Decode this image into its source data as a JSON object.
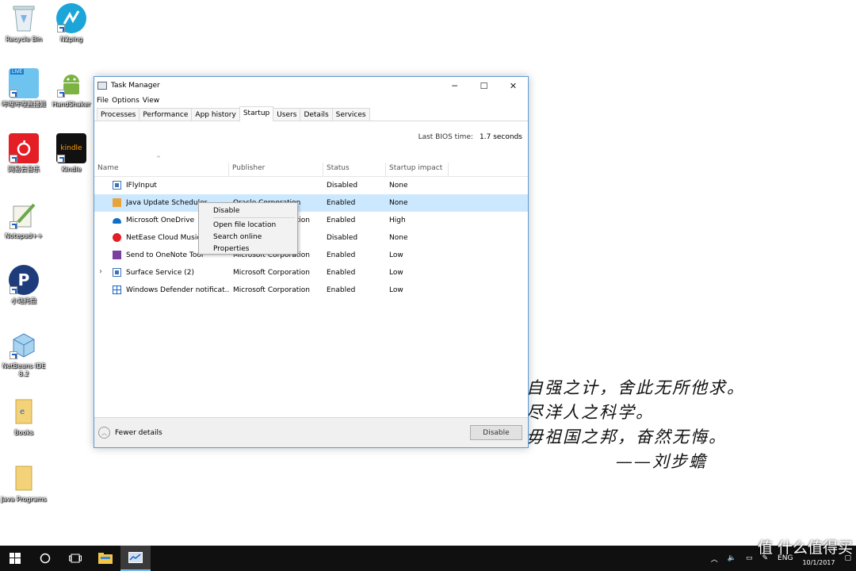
{
  "desktop": {
    "icons": [
      {
        "label": "Recycle Bin"
      },
      {
        "label": "N2ping"
      },
      {
        "label": "哔哩哔哩直播姬"
      },
      {
        "label": "HandShaker"
      },
      {
        "label": "网易云音乐"
      },
      {
        "label": "Kindle"
      },
      {
        "label": "Notepad++"
      },
      {
        "label": "小站托盘"
      },
      {
        "label": "NetBeans IDE 8.2"
      },
      {
        "label": "Books"
      },
      {
        "label": "Java Programs"
      }
    ],
    "poem_lines": [
      "自强之计，舍此无所他求。",
      "尽洋人之科学。",
      "毋祖国之邦，奋然无悔。"
    ],
    "poem_signature": "——刘步蟾"
  },
  "window": {
    "title": "Task Manager",
    "menu": [
      "File",
      "Options",
      "View"
    ],
    "tabs": [
      "Processes",
      "Performance",
      "App history",
      "Startup",
      "Users",
      "Details",
      "Services"
    ],
    "active_tab": "Startup",
    "bios_label": "Last BIOS time:",
    "bios_value": "1.7 seconds",
    "columns": {
      "name": "Name",
      "publisher": "Publisher",
      "status": "Status",
      "impact": "Startup impact"
    },
    "rows": [
      {
        "name": "IFlyInput",
        "publisher": "",
        "status": "Disabled",
        "impact": "None",
        "icon": "app-window-icon"
      },
      {
        "name": "Java Update Scheduler",
        "publisher": "Oracle Corporation",
        "status": "Enabled",
        "impact": "None",
        "icon": "java-icon"
      },
      {
        "name": "Microsoft OneDrive",
        "publisher": "Microsoft Corporation",
        "status": "Enabled",
        "impact": "High",
        "icon": "onedrive-cloud-icon"
      },
      {
        "name": "NetEase Cloud Music",
        "publisher": "",
        "status": "Disabled",
        "impact": "None",
        "icon": "netease-music-icon"
      },
      {
        "name": "Send to OneNote Tool",
        "publisher": "Microsoft Corporation",
        "status": "Enabled",
        "impact": "Low",
        "icon": "onenote-icon"
      },
      {
        "name": "Surface Service (2)",
        "publisher": "Microsoft Corporation",
        "status": "Enabled",
        "impact": "Low",
        "icon": "app-window-icon"
      },
      {
        "name": "Windows Defender notificat...",
        "publisher": "Microsoft Corporation",
        "status": "Enabled",
        "impact": "Low",
        "icon": "defender-icon"
      }
    ],
    "selected_row": "Java Update Scheduler",
    "context_menu": [
      "Disable",
      "Open file location",
      "Search online",
      "Properties"
    ],
    "footer": {
      "fewer_details": "Fewer details",
      "disable_button": "Disable"
    }
  },
  "taskbar": {
    "tray_language": "ENG",
    "clock_date": "10/1/2017"
  },
  "watermark": "值 什么值得买"
}
